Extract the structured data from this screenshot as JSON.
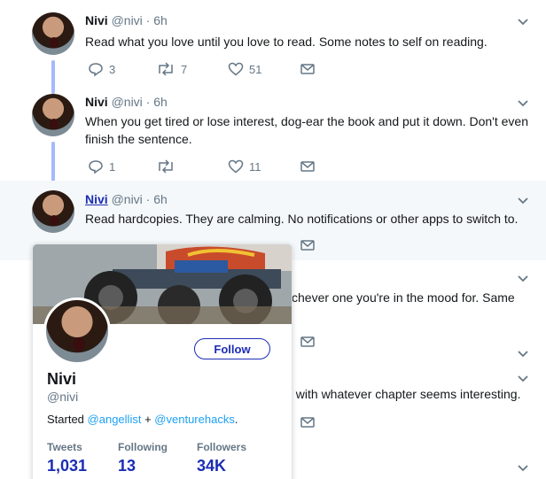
{
  "tweets": [
    {
      "name": "Nivi",
      "handle": "@nivi",
      "time": "6h",
      "text": "Read what you love until you love to read. Some notes to self on reading.",
      "reply_count": "3",
      "retweet_count": "7",
      "like_count": "51"
    },
    {
      "name": "Nivi",
      "handle": "@nivi",
      "time": "6h",
      "text": "When you get tired or lose interest, dog-ear the book and put it down. Don't even finish the sentence.",
      "reply_count": "1",
      "retweet_count": "",
      "like_count": "11"
    },
    {
      "name": "Nivi",
      "handle": "@nivi",
      "time": "6h",
      "text": "Read hardcopies. They are calming. No notifications or other apps to switch to."
    }
  ],
  "partial_text": {
    "tweet4": "chever one you're in the mood for. Same",
    "tweet5": "t with whatever chapter seems interesting."
  },
  "meta_separator": "·",
  "card": {
    "name": "Nivi",
    "handle": "@nivi",
    "follow_label": "Follow",
    "bio_prefix": "Started",
    "bio_link1": "@angellist",
    "bio_plus": "+",
    "bio_link2": "@venturehacks",
    "bio_suffix": ".",
    "stats": [
      {
        "label": "Tweets",
        "value": "1,031"
      },
      {
        "label": "Following",
        "value": "13"
      },
      {
        "label": "Followers",
        "value": "34K"
      }
    ]
  },
  "colors": {
    "accent": "#1b2db3",
    "thread_line": "#a6b8ff",
    "muted": "#657786",
    "link": "#1da1f2"
  },
  "icons": [
    "chevron-down-icon",
    "reply-icon",
    "retweet-icon",
    "like-icon",
    "message-icon"
  ]
}
